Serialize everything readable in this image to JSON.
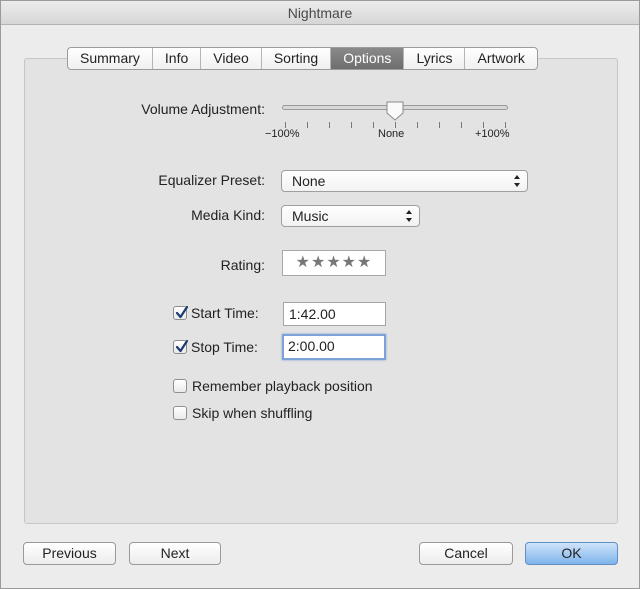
{
  "window": {
    "title": "Nightmare"
  },
  "tabs": [
    "Summary",
    "Info",
    "Video",
    "Sorting",
    "Options",
    "Lyrics",
    "Artwork"
  ],
  "active_tab": "Options",
  "volume": {
    "label": "Volume Adjustment:",
    "min_label": "−100%",
    "mid_label": "None",
    "max_label": "+100%",
    "value_percent": 0
  },
  "equalizer": {
    "label": "Equalizer Preset:",
    "value": "None"
  },
  "media_kind": {
    "label": "Media Kind:",
    "value": "Music"
  },
  "rating": {
    "label": "Rating:",
    "stars": "★★★★★",
    "value": 0
  },
  "start_time": {
    "label": "Start Time:",
    "value": "1:42.00",
    "checked": true
  },
  "stop_time": {
    "label": "Stop Time:",
    "value": "2:00.00",
    "checked": true
  },
  "remember_position": {
    "label": "Remember playback position",
    "checked": false
  },
  "skip_shuffling": {
    "label": "Skip when shuffling",
    "checked": false
  },
  "buttons": {
    "previous": "Previous",
    "next": "Next",
    "cancel": "Cancel",
    "ok": "OK"
  },
  "colors": {
    "active_tab": "#7c7c7c",
    "default_button": "#7fb3eb",
    "focus_ring": "#7da2d8"
  }
}
